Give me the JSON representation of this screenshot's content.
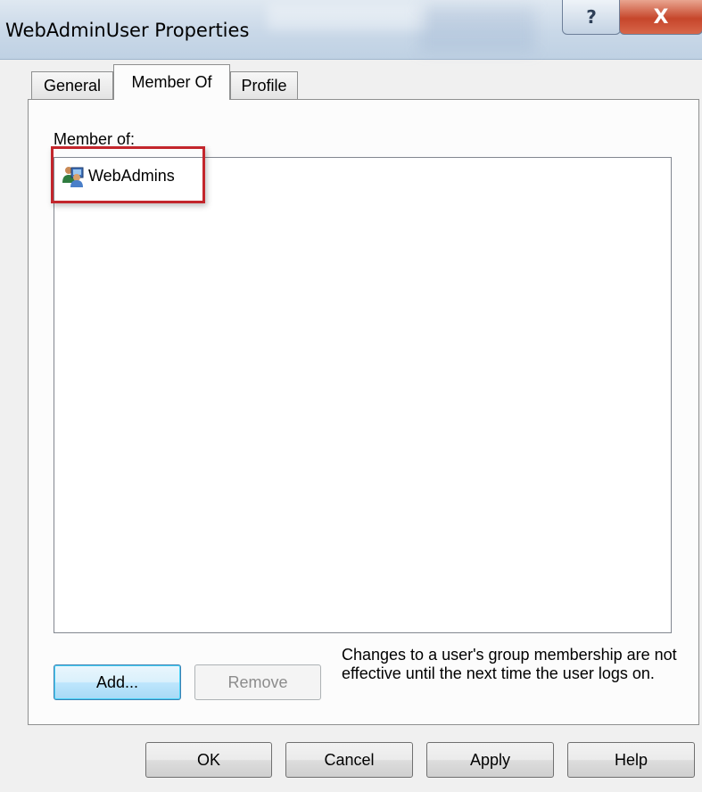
{
  "window": {
    "title": "WebAdminUser Properties",
    "help_glyph": "?",
    "close_glyph": "X"
  },
  "tabs": [
    {
      "label": "General",
      "active": false
    },
    {
      "label": "Member Of",
      "active": true
    },
    {
      "label": "Profile",
      "active": false
    }
  ],
  "member_of": {
    "label": "Member of:",
    "items": [
      {
        "name": "WebAdmins",
        "icon": "user-group-icon"
      }
    ]
  },
  "buttons": {
    "add": "Add...",
    "remove": "Remove",
    "ok": "OK",
    "cancel": "Cancel",
    "apply": "Apply",
    "help": "Help"
  },
  "note": "Changes to a user's group membership are not effective until the next time the user logs on.",
  "colors": {
    "highlight_border": "#c3262c",
    "default_button_border": "#3c7fb1",
    "close_button": "#c6462b"
  }
}
